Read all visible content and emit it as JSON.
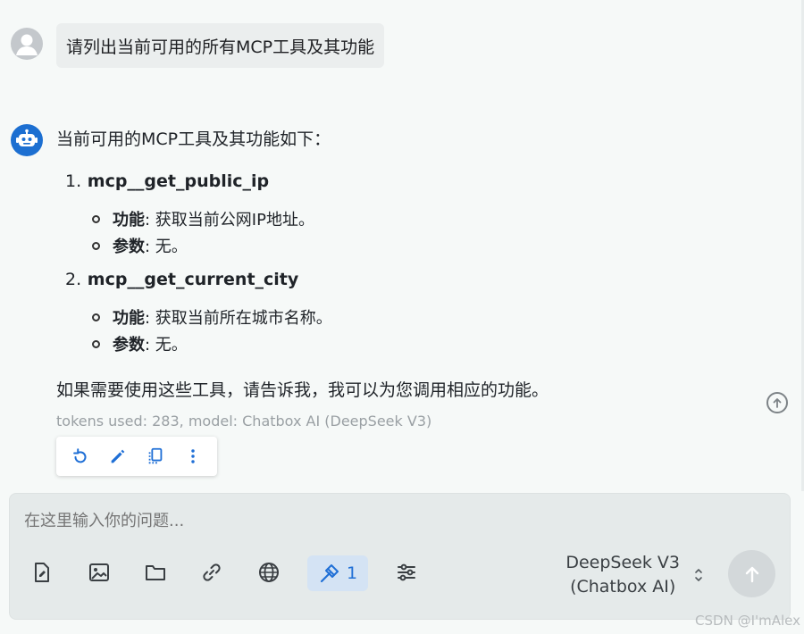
{
  "conversation": {
    "user_message": "请列出当前可用的所有MCP工具及其功能",
    "assistant": {
      "intro": "当前可用的MCP工具及其功能如下：",
      "tools": [
        {
          "number": "1.",
          "name": "mcp__get_public_ip",
          "function_label": "功能",
          "function_text": ": 获取当前公网IP地址。",
          "params_label": "参数",
          "params_text": ": 无。"
        },
        {
          "number": "2.",
          "name": "mcp__get_current_city",
          "function_label": "功能",
          "function_text": ": 获取当前所在城市名称。",
          "params_label": "参数",
          "params_text": ": 无。"
        }
      ],
      "closing": "如果需要使用这些工具，请告诉我，我可以为您调用相应的功能。",
      "meta": "tokens used: 283, model: Chatbox AI (DeepSeek V3)"
    },
    "message_actions": [
      "refresh-icon",
      "edit-icon",
      "copy-icon",
      "more-vertical-icon"
    ]
  },
  "composer": {
    "placeholder": "在这里输入你的问题...",
    "toolbar_icons": [
      "file-icon",
      "image-icon",
      "folder-icon",
      "link-icon",
      "globe-icon",
      "hammer-icon",
      "sliders-icon"
    ],
    "mcp_count": "1",
    "model_line1": "DeepSeek V3",
    "model_line2": "(Chatbox AI)"
  },
  "watermark": "CSDN @I'mAlex",
  "colors": {
    "accent": "#1f6fd6",
    "background": "#f6f9f8",
    "composer_bg": "#e5eaea",
    "user_bubble": "#ebeeee"
  }
}
